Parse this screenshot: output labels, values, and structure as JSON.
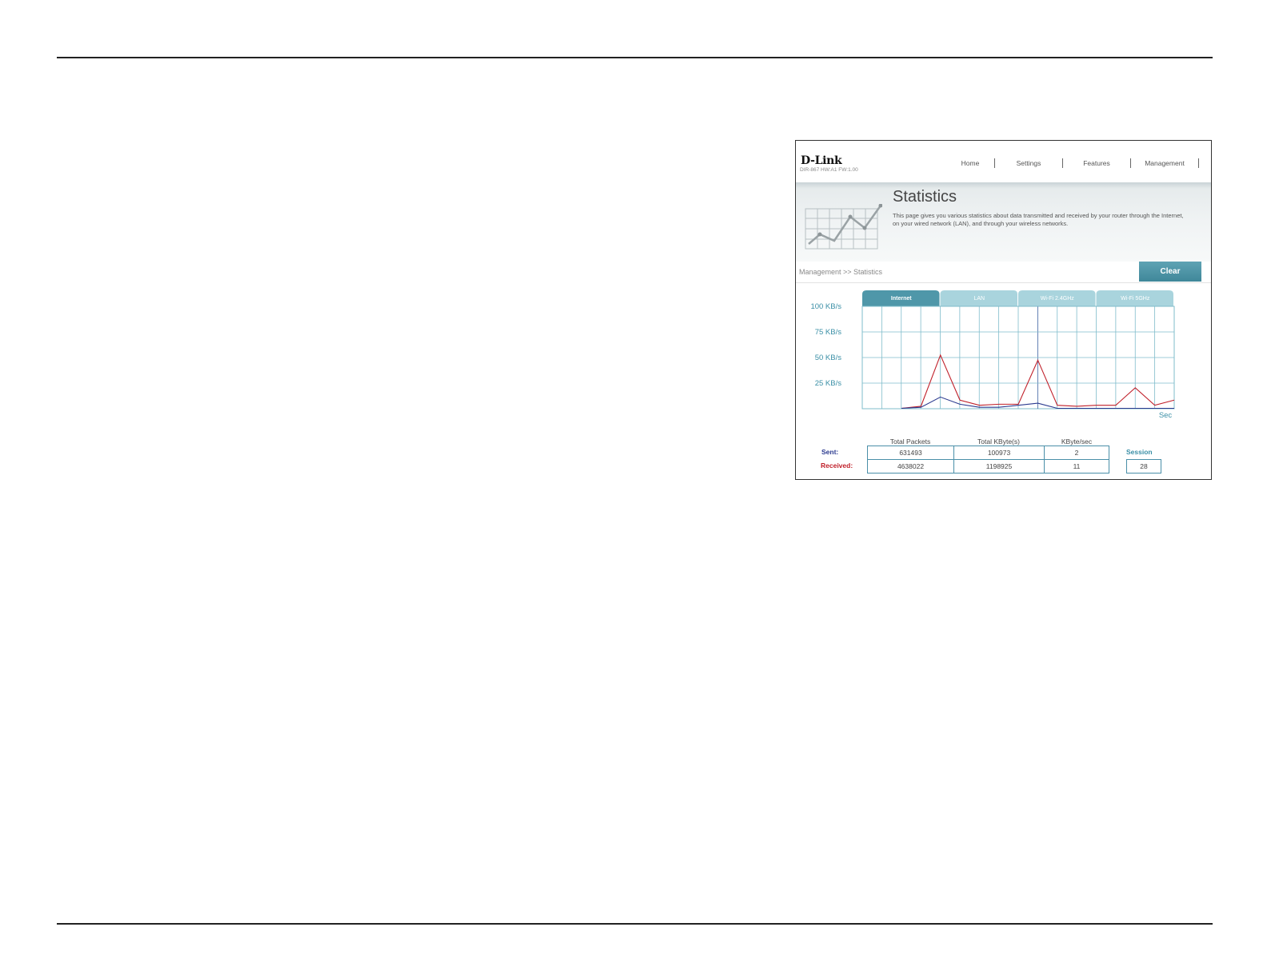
{
  "header": {
    "logo": "D-Link",
    "firmware": "DIR-867 HW:A1 FW:1.00"
  },
  "nav": {
    "items": [
      "Home",
      "Settings",
      "Features",
      "Management"
    ]
  },
  "banner": {
    "title": "Statistics",
    "description": "This page gives you various statistics about data transmitted and received by your router through the Internet, on your wired network (LAN), and through your wireless networks."
  },
  "breadcrumb": "Management >> Statistics",
  "clear_label": "Clear",
  "tabs": [
    {
      "label": "Internet",
      "active": true
    },
    {
      "label": "LAN",
      "active": false
    },
    {
      "label": "Wi-Fi 2.4GHz",
      "active": false
    },
    {
      "label": "Wi-Fi 5GHz",
      "active": false
    }
  ],
  "chart_data": {
    "type": "line",
    "yticks": [
      "100 KB/s",
      "75 KB/s",
      "50 KB/s",
      "25 KB/s"
    ],
    "ylim": [
      0,
      100
    ],
    "xlabel": "Sec",
    "grid": true,
    "series": [
      {
        "color": "#c0202a",
        "values": [
          0,
          2,
          52,
          8,
          3,
          4,
          4,
          47,
          3,
          2,
          3,
          3,
          20,
          3,
          8
        ]
      },
      {
        "color": "#2b3a8f",
        "values": [
          0,
          1,
          11,
          4,
          1,
          1,
          3,
          5,
          0,
          0,
          0,
          0,
          0,
          0,
          0
        ]
      }
    ]
  },
  "stats": {
    "headers": [
      "Total Packets",
      "Total KByte(s)",
      "KByte/sec"
    ],
    "sent_label": "Sent:",
    "received_label": "Received:",
    "sent": [
      "631493",
      "100973",
      "2"
    ],
    "received": [
      "4638022",
      "1198925",
      "11"
    ],
    "session_label": "Session",
    "session_value": "28"
  },
  "colors": {
    "accent": "#3f8799",
    "tab_active": "#4f97a9",
    "tab_inactive": "#a9d4dd",
    "grid": "#7fbccb",
    "sent": "#2b3a8f",
    "received": "#c0202a"
  }
}
